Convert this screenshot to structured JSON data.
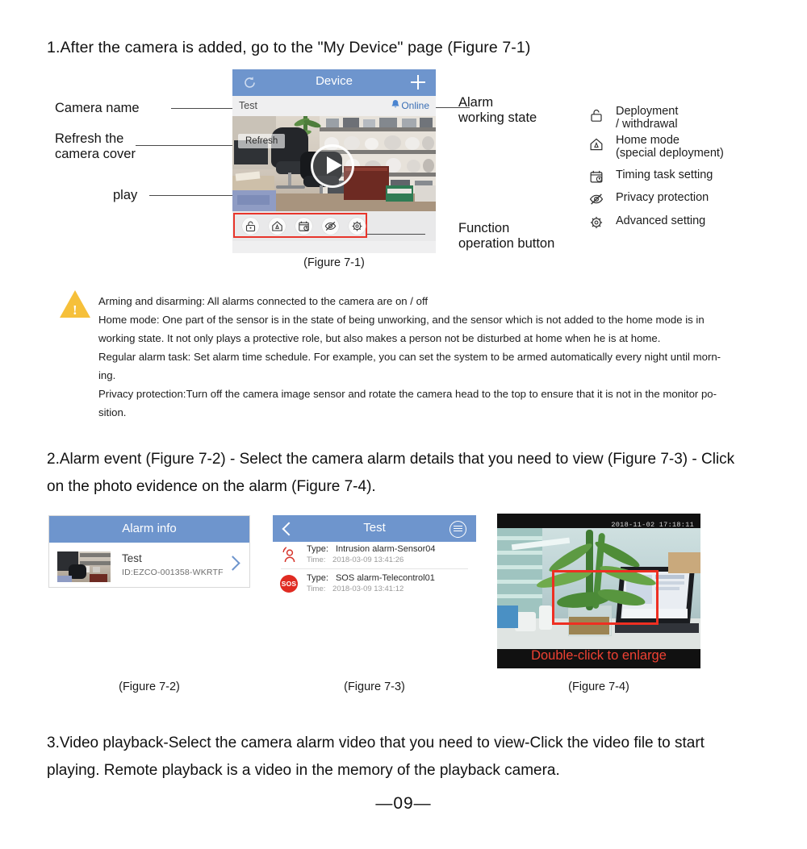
{
  "page": {
    "number": "—09—"
  },
  "sections": {
    "step1_heading": "1.After the camera is added, go to the \"My Device\" page (Figure 7-1)",
    "step2_line1": "2.Alarm event (Figure 7-2) - Select the camera alarm details that you need to view (Figure 7-3) - Click",
    "step2_line2": "on the photo evidence on the alarm  (Figure 7-4).",
    "step3_line1": "3.Video playback-Select the camera alarm video that you need to view-Click the video file to start",
    "step3_line2": "playing. Remote playback is a video in the memory of the playback camera."
  },
  "annotations": {
    "camera_name": "Camera name",
    "refresh_cover_line1": "Refresh the",
    "refresh_cover_line2": "camera cover",
    "play": "play",
    "alarm_state_line1": "Alarm",
    "alarm_state_line2": "working state",
    "function_btn_line1": "Function",
    "function_btn_line2": "operation button"
  },
  "figure1": {
    "caption": "(Figure 7-1)",
    "header_title": "Device",
    "refresh_icon": "refresh-icon",
    "add_icon": "plus-icon",
    "camera_name": "Test",
    "status": "Online",
    "status_icon": "bell-icon",
    "refresh_pill": "Refresh",
    "play_icon": "play-icon",
    "tools": [
      {
        "name": "deployment-withdrawal",
        "icon": "unlock-icon"
      },
      {
        "name": "home-mode",
        "icon": "home-icon"
      },
      {
        "name": "timing-task-setting",
        "icon": "calendar-clock-icon"
      },
      {
        "name": "privacy-protection",
        "icon": "eye-slash-icon"
      },
      {
        "name": "advanced-setting",
        "icon": "gear-icon"
      }
    ],
    "highlight_color": "#e8352b",
    "header_color": "#6e95cd"
  },
  "legend": [
    {
      "icon": "unlock-icon",
      "line1": "Deployment",
      "line2": "/ withdrawal"
    },
    {
      "icon": "home-icon",
      "line1": "Home mode",
      "line2": "(special deployment)"
    },
    {
      "icon": "calendar-clock-icon",
      "line1": "Timing task setting",
      "line2": ""
    },
    {
      "icon": "eye-slash-icon",
      "line1": "Privacy protection",
      "line2": ""
    },
    {
      "icon": "gear-icon",
      "line1": "Advanced setting",
      "line2": ""
    }
  ],
  "note": {
    "icon": "warning-triangle-icon",
    "bang": "!",
    "lines": [
      "Arming and disarming: All alarms connected to the camera are on / off",
      "Home mode: One part of the sensor is in the state of being unworking, and the sensor which is not added to the home mode is in",
      "working state. It not only plays a protective role, but also makes a person not be disturbed at home when he is at home.",
      "Regular alarm task: Set alarm time schedule. For example, you can set the system to be armed automatically every night until morn-",
      "ing.",
      "Privacy protection:Turn off the camera image sensor and rotate the camera head to the top to ensure that it is not in the monitor po-",
      "sition."
    ]
  },
  "figure2": {
    "caption": "(Figure 7-2)",
    "header_title": "Alarm info",
    "item_name": "Test",
    "item_id": "ID:EZCO-001358-WKRTF",
    "chevron": "chevron-right-icon"
  },
  "figure3": {
    "caption": "(Figure 7-3)",
    "header_title": "Test",
    "back_icon": "chevron-left-icon",
    "menu_icon": "hamburger-menu-icon",
    "events": [
      {
        "icon": "intrusion-person-icon",
        "type_label": "Type:",
        "type_value": "Intrusion alarm-Sensor04",
        "time_label": "Time:",
        "time_value": "2018-03-09 13:41:26"
      },
      {
        "icon": "sos-icon",
        "icon_text": "SOS",
        "type_label": "Type:",
        "type_value": "SOS alarm-Telecontrol01",
        "time_label": "Time:",
        "time_value": "2018-03-09 13:41:12"
      }
    ]
  },
  "figure4": {
    "caption": "(Figure 7-4)",
    "timestamp": "2018-11-02 17:18:11",
    "overlay_text": "Double-click to enlarge",
    "box_color": "#ee2f22"
  }
}
